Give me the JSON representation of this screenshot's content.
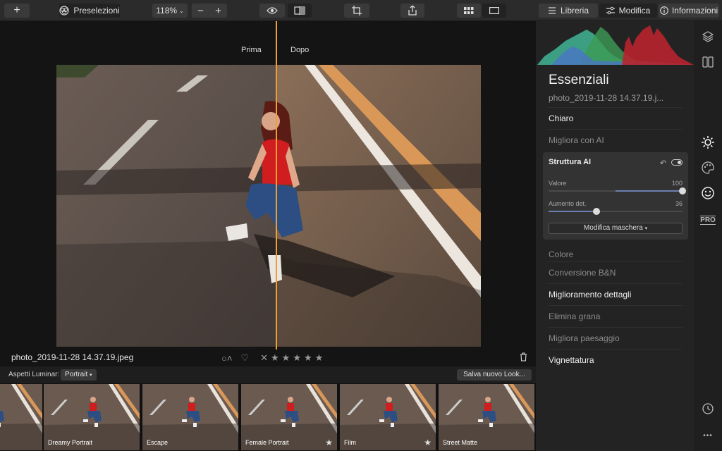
{
  "toolbar": {
    "add_label": "+",
    "presets_label": "Preselezioni",
    "zoom_label": "118%",
    "zoom_out_label": "−",
    "zoom_in_label": "+",
    "tab_library": "Libreria",
    "tab_edit": "Modifica",
    "tab_info": "Informazioni"
  },
  "viewer": {
    "before_label": "Prima",
    "after_label": "Dopo",
    "filename": "photo_2019-11-28 14.37.19.jpeg",
    "rating_stars": 0,
    "split_color": "#f0a030"
  },
  "looks": {
    "label": "Aspetti Luminar:",
    "selected": "Portrait",
    "save_label": "Salva nuovo Look...",
    "items": [
      {
        "label": "",
        "starred": false
      },
      {
        "label": "Dreamy Portrait",
        "starred": false
      },
      {
        "label": "Escape",
        "starred": false
      },
      {
        "label": "Female Portrait",
        "starred": true
      },
      {
        "label": "Film",
        "starred": true
      },
      {
        "label": "Street Matte",
        "starred": false
      }
    ]
  },
  "panel": {
    "title": "Essenziali",
    "filename": "photo_2019-11-28 14.37.19.j...",
    "sections": {
      "chiaro": "Chiaro",
      "migliora_ai": "Migliora con AI",
      "colore": "Colore",
      "bn": "Conversione B&N",
      "dettagli": "Miglioramento dettagli",
      "grana": "Elimina grana",
      "paesaggio": "Migliora paesaggio",
      "vignettatura": "Vignettatura"
    },
    "ai_structure": {
      "title": "Struttura AI",
      "amount_label": "Valore",
      "amount_value": "100",
      "amount_fraction": 1.0,
      "detail_label": "Aumento det.",
      "detail_value": "36",
      "detail_fraction": 0.36,
      "mask_button": "Modifica maschera"
    }
  },
  "rail": {
    "icons": [
      "layers-icon",
      "compare-icon",
      "sun-icon",
      "palette-icon",
      "smile-icon",
      "pro-icon",
      "history-icon",
      "more-icon"
    ],
    "pro_label": "PRO",
    "more_label": "•••"
  }
}
